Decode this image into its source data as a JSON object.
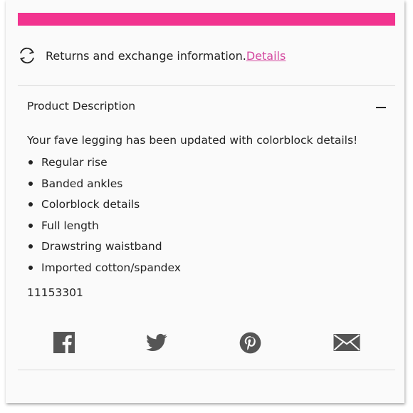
{
  "returns": {
    "text": "Returns and exchange information.",
    "link": "Details",
    "icon": "exchange-arrows-icon"
  },
  "description": {
    "title": "Product Description",
    "collapse_icon": "minus-icon",
    "intro": "Your fave legging has been updated with colorblock details!",
    "features": [
      "Regular rise",
      "Banded ankles",
      "Colorblock details",
      "Full length",
      "Drawstring waistband",
      "Imported cotton/spandex"
    ],
    "sku": "11153301"
  },
  "share": {
    "icons": [
      "facebook-icon",
      "twitter-icon",
      "pinterest-icon",
      "email-icon"
    ]
  },
  "colors": {
    "accent_bar": "#f2338f",
    "link": "#d44aa0",
    "icon_gray": "#555555"
  }
}
